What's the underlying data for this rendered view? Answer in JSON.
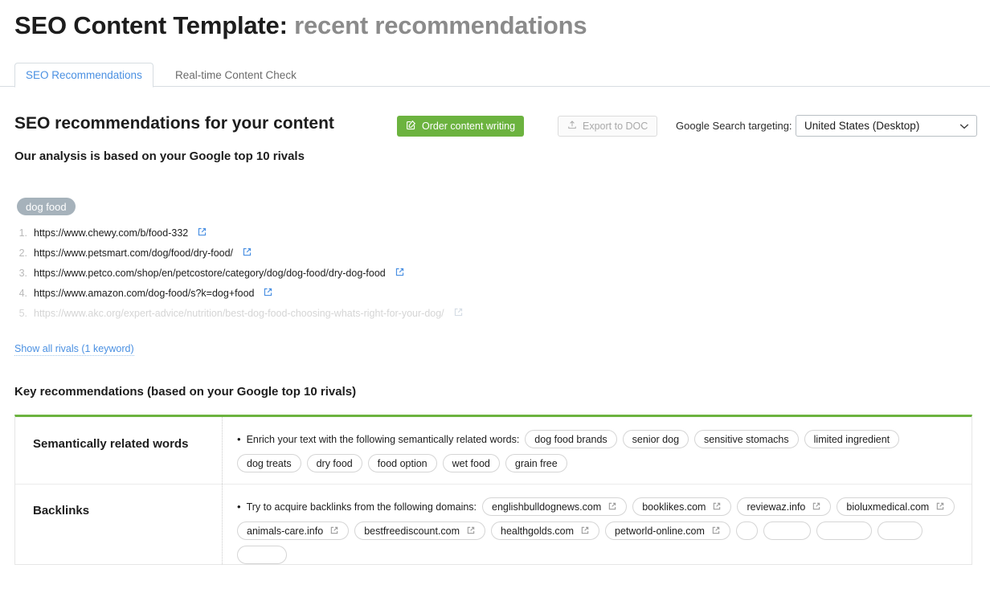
{
  "header": {
    "title_main": "SEO Content Template:",
    "title_sub": "recent recommendations"
  },
  "tabs": [
    {
      "label": "SEO Recommendations",
      "active": true
    },
    {
      "label": "Real-time Content Check",
      "active": false
    }
  ],
  "toolbar": {
    "heading": "SEO recommendations for your content",
    "order_button": "Order content writing",
    "export_button": "Export to DOC",
    "targeting_label": "Google Search targeting:",
    "targeting_value": "United States (Desktop)"
  },
  "analysis": {
    "subheading": "Our analysis is based on your Google top 10 rivals",
    "keyword": "dog food",
    "rivals": [
      {
        "n": "1.",
        "url": "https://www.chewy.com/b/food-332",
        "faded": false
      },
      {
        "n": "2.",
        "url": "https://www.petsmart.com/dog/food/dry-food/",
        "faded": false
      },
      {
        "n": "3.",
        "url": "https://www.petco.com/shop/en/petcostore/category/dog/dog-food/dry-dog-food",
        "faded": false
      },
      {
        "n": "4.",
        "url": "https://www.amazon.com/dog-food/s?k=dog+food",
        "faded": false
      },
      {
        "n": "5.",
        "url": "https://www.akc.org/expert-advice/nutrition/best-dog-food-choosing-whats-right-for-your-dog/",
        "faded": true
      }
    ],
    "show_all_link": "Show all rivals (1 keyword)"
  },
  "recommendations": {
    "heading": "Key recommendations (based on your Google top 10 rivals)",
    "rows": [
      {
        "label": "Semantically related words",
        "text": "Enrich your text with the following semantically related words:",
        "chips": [
          "dog food brands",
          "senior dog",
          "sensitive stomachs",
          "limited ingredient",
          "dog treats",
          "dry food",
          "food option",
          "wet food",
          "grain free"
        ]
      },
      {
        "label": "Backlinks",
        "text": "Try to acquire backlinks from the following domains:",
        "chips": [
          "englishbulldognews.com",
          "booklikes.com",
          "reviewaz.info",
          "bioluxmedical.com",
          "animals-care.info",
          "bestfreediscount.com",
          "healthgolds.com",
          "petworld-online.com"
        ]
      }
    ]
  },
  "icons": {
    "order": "compose-icon",
    "export": "upload-icon",
    "external": "external-link-icon",
    "chevron": "chevron-down-icon"
  },
  "colors": {
    "accent_green": "#6cb33f",
    "link_blue": "#4a90e2",
    "keyword_gray": "#a6b2bb"
  }
}
